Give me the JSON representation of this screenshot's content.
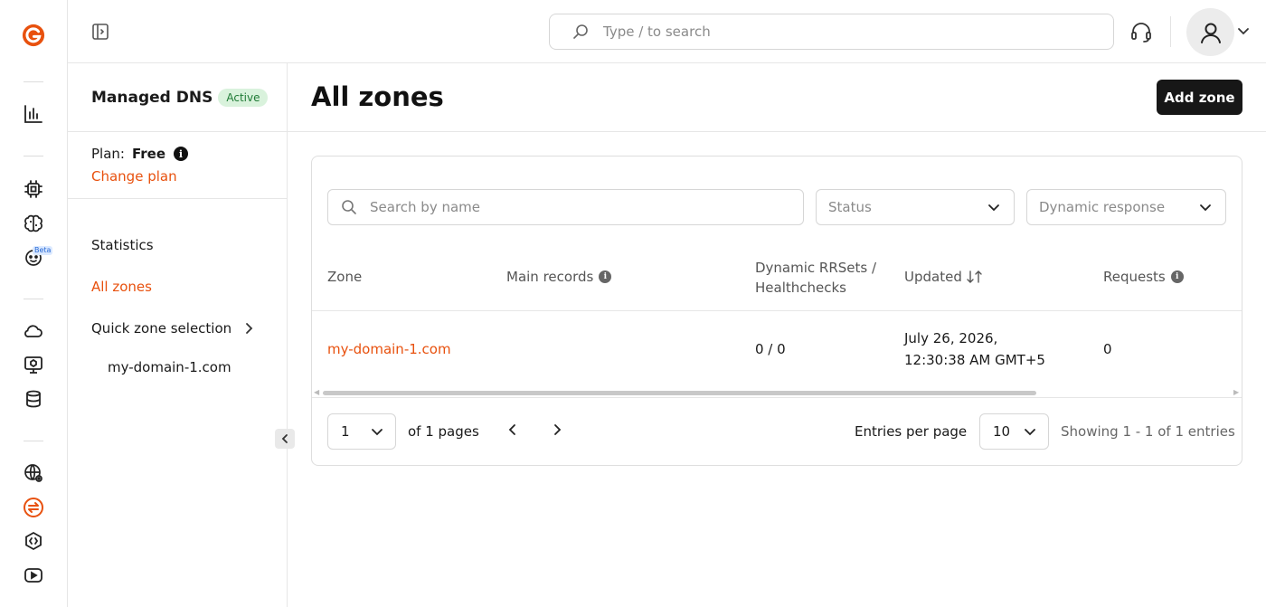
{
  "rail": {
    "items": [
      {
        "icon": "logo-icon"
      },
      {
        "icon": "analytics-icon"
      },
      {
        "icon": "chip-icon"
      },
      {
        "icon": "brain-icon"
      },
      {
        "icon": "bot-icon",
        "badge": "Beta"
      },
      {
        "icon": "cloud-icon"
      },
      {
        "icon": "monitor-icon"
      },
      {
        "icon": "database-icon"
      },
      {
        "icon": "globe-icon"
      },
      {
        "icon": "dns-icon",
        "active": true
      },
      {
        "icon": "code-icon"
      },
      {
        "icon": "video-icon"
      }
    ],
    "accent": "#e8510e"
  },
  "topbar": {
    "search_placeholder": "Type / to search"
  },
  "sidebar": {
    "title": "Managed DNS",
    "status_badge": "Active",
    "plan_label": "Plan:",
    "plan_value": "Free",
    "change_plan": "Change plan",
    "nav": {
      "statistics": "Statistics",
      "all_zones": "All zones",
      "quick_zone": "Quick zone selection",
      "zone_item": "my-domain-1.com"
    }
  },
  "main": {
    "title": "All zones",
    "add_button": "Add zone",
    "filters": {
      "search_placeholder": "Search by name",
      "status": "Status",
      "dynamic": "Dynamic response"
    },
    "table": {
      "headers": {
        "zone": "Zone",
        "main_records": "Main records",
        "dynamic_line1": "Dynamic RRSets /",
        "dynamic_line2": "Healthchecks",
        "updated": "Updated",
        "requests": "Requests"
      },
      "rows": [
        {
          "zone": "my-domain-1.com",
          "main_records": "",
          "dynamic": "0 / 0",
          "updated_line1": "July 26, 2026,",
          "updated_line2": "12:30:38 AM GMT+5",
          "requests": "0"
        }
      ]
    },
    "pagination": {
      "page": "1",
      "of_pages": "of 1 pages",
      "entries_label": "Entries per page",
      "entries_value": "10",
      "showing": "Showing 1 - 1 of 1 entries"
    }
  },
  "colors": {
    "accent": "#e8510e",
    "badge_bg": "#d9f2dc",
    "badge_text": "#1f7a35",
    "primary_button": "#171717"
  }
}
